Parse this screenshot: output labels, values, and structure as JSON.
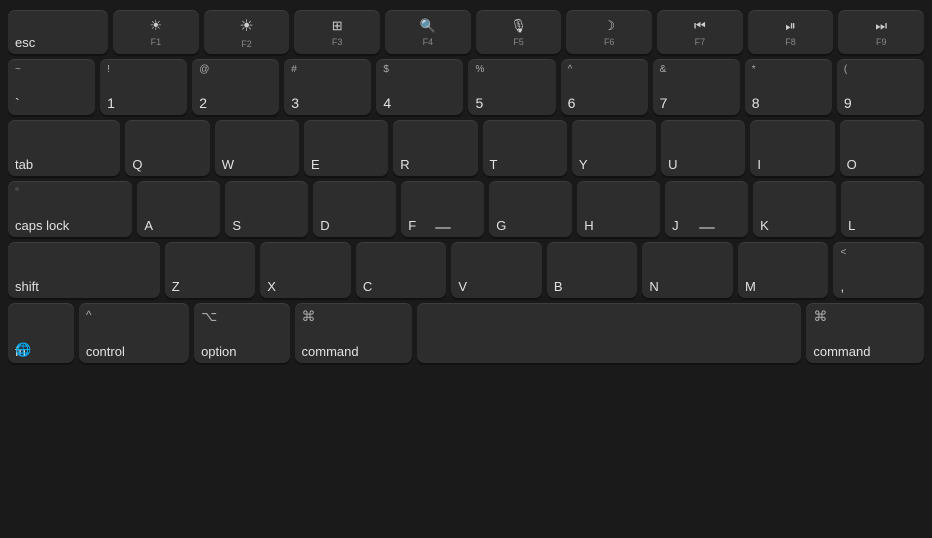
{
  "keyboard": {
    "rows": {
      "fn": [
        {
          "id": "esc",
          "label": "esc",
          "wide": true
        },
        {
          "id": "f1",
          "icon": "☀",
          "sub": "F1"
        },
        {
          "id": "f2",
          "icon": "☀",
          "sub": "F2"
        },
        {
          "id": "f3",
          "icon": "⊞",
          "sub": "F3"
        },
        {
          "id": "f4",
          "icon": "🔍",
          "sub": "F4"
        },
        {
          "id": "f5",
          "icon": "🎙",
          "sub": "F5"
        },
        {
          "id": "f6",
          "icon": "🌙",
          "sub": "F6"
        },
        {
          "id": "f7",
          "icon": "⏮",
          "sub": "F7"
        },
        {
          "id": "f8",
          "icon": "⏯",
          "sub": "F8"
        },
        {
          "id": "f9",
          "icon": "⏭",
          "sub": "F9"
        }
      ],
      "numbers": [
        {
          "id": "tilde",
          "primary": "`",
          "secondary": "~"
        },
        {
          "id": "1",
          "primary": "1",
          "secondary": "!"
        },
        {
          "id": "2",
          "primary": "2",
          "secondary": "@"
        },
        {
          "id": "3",
          "primary": "3",
          "secondary": "#"
        },
        {
          "id": "4",
          "primary": "4",
          "secondary": "$"
        },
        {
          "id": "5",
          "primary": "5",
          "secondary": "%"
        },
        {
          "id": "6",
          "primary": "6",
          "secondary": "^"
        },
        {
          "id": "7",
          "primary": "7",
          "secondary": "&"
        },
        {
          "id": "8",
          "primary": "8",
          "secondary": "*"
        },
        {
          "id": "9",
          "primary": "9",
          "secondary": "("
        }
      ],
      "qwerty": [
        "Q",
        "W",
        "E",
        "R",
        "T",
        "Y",
        "U",
        "I",
        "O"
      ],
      "asdf": [
        "A",
        "S",
        "D",
        "F",
        "G",
        "H",
        "J",
        "K",
        "L"
      ],
      "zxcv": [
        "Z",
        "X",
        "C",
        "V",
        "B",
        "N",
        "M"
      ]
    },
    "bottom": {
      "fn_label": "fn",
      "globe": "🌐",
      "control_arrow": "^",
      "control_label": "control",
      "option_symbol": "⌥",
      "option_label": "option",
      "command_symbol": "⌘",
      "command_label": "command"
    }
  }
}
